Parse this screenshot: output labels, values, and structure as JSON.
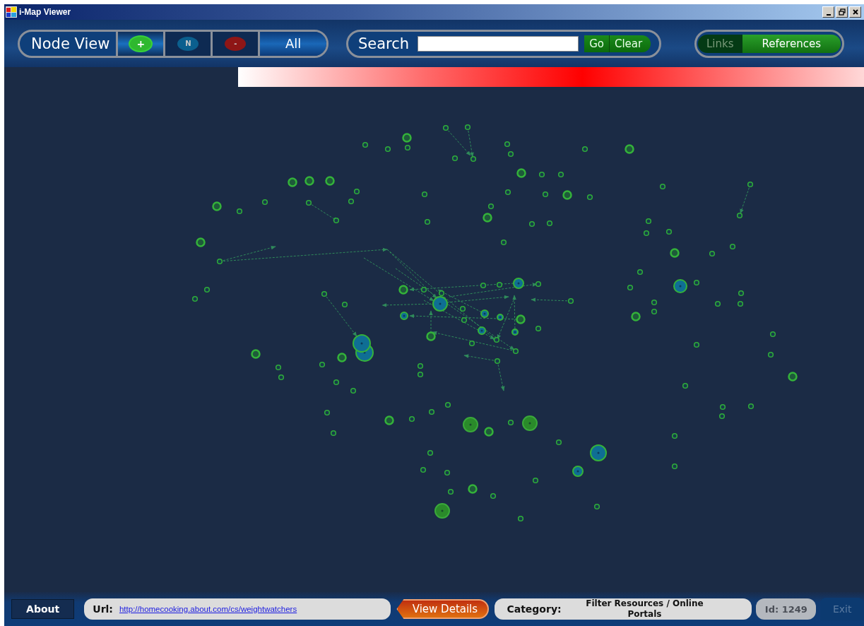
{
  "window": {
    "title": "i-Map Viewer"
  },
  "node_view": {
    "label": "Node View",
    "filters": [
      {
        "symbol": "+",
        "color": "#2fb82f",
        "selected": true
      },
      {
        "symbol": "N",
        "color": "#0b5f8e",
        "selected": false
      },
      {
        "symbol": "-",
        "color": "#8e1616",
        "selected": false
      }
    ],
    "all": "All"
  },
  "search": {
    "label": "Search",
    "go": "Go",
    "clear": "Clear"
  },
  "views": [
    {
      "label": "Links",
      "selected": false
    },
    {
      "label": "References",
      "selected": true
    }
  ],
  "status_bar": {
    "about": "About",
    "url_label": "Url:",
    "url": "http://homecooking.about.com/cs/weightwatchers",
    "view_details": "View Details",
    "category_label": "Category:",
    "category": "Filter Resources / Online Portals",
    "id": {
      "text": "Id: 1249",
      "disabled": true
    },
    "exit": {
      "label": "Exit",
      "disabled": true
    }
  }
}
